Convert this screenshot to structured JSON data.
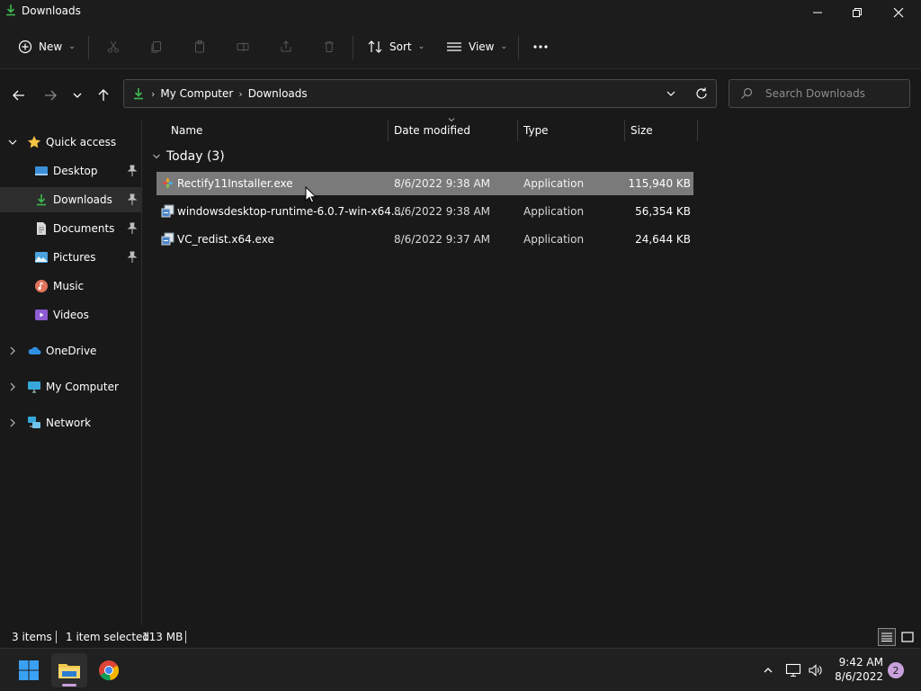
{
  "window": {
    "title": "Downloads"
  },
  "toolbar": {
    "new_label": "New",
    "sort_label": "Sort",
    "view_label": "View"
  },
  "address": {
    "crumbs": [
      "My Computer",
      "Downloads"
    ]
  },
  "search": {
    "placeholder": "Search Downloads"
  },
  "sidebar": {
    "quick_access": "Quick access",
    "items": [
      {
        "label": "Desktop",
        "pinned": true,
        "icon": "desktop-icon"
      },
      {
        "label": "Downloads",
        "pinned": true,
        "selected": true,
        "icon": "download-icon"
      },
      {
        "label": "Documents",
        "pinned": true,
        "icon": "document-icon"
      },
      {
        "label": "Pictures",
        "pinned": true,
        "icon": "pictures-icon"
      },
      {
        "label": "Music",
        "icon": "music-icon"
      },
      {
        "label": "Videos",
        "icon": "videos-icon"
      }
    ],
    "roots": [
      {
        "label": "OneDrive",
        "icon": "cloud-icon"
      },
      {
        "label": "My Computer",
        "icon": "monitor-icon"
      },
      {
        "label": "Network",
        "icon": "network-icon"
      }
    ]
  },
  "columns": {
    "name": "Name",
    "date": "Date modified",
    "type": "Type",
    "size": "Size"
  },
  "group": {
    "label": "Today (3)"
  },
  "files": [
    {
      "name": "Rectify11Installer.exe",
      "date": "8/6/2022 9:38 AM",
      "type": "Application",
      "size": "115,940 KB",
      "selected": true
    },
    {
      "name": "windowsdesktop-runtime-6.0.7-win-x64....",
      "date": "8/6/2022 9:38 AM",
      "type": "Application",
      "size": "56,354 KB"
    },
    {
      "name": "VC_redist.x64.exe",
      "date": "8/6/2022 9:37 AM",
      "type": "Application",
      "size": "24,644 KB"
    }
  ],
  "status": {
    "items": "3 items",
    "selected": "1 item selected",
    "size": "113 MB"
  },
  "taskbar": {
    "time": "9:42 AM",
    "date": "8/6/2022",
    "notifications": "2"
  },
  "colors": {
    "accent": "#2ea043",
    "selected_row": "#7a7a7a",
    "folder_yellow": "#f2c94c"
  }
}
